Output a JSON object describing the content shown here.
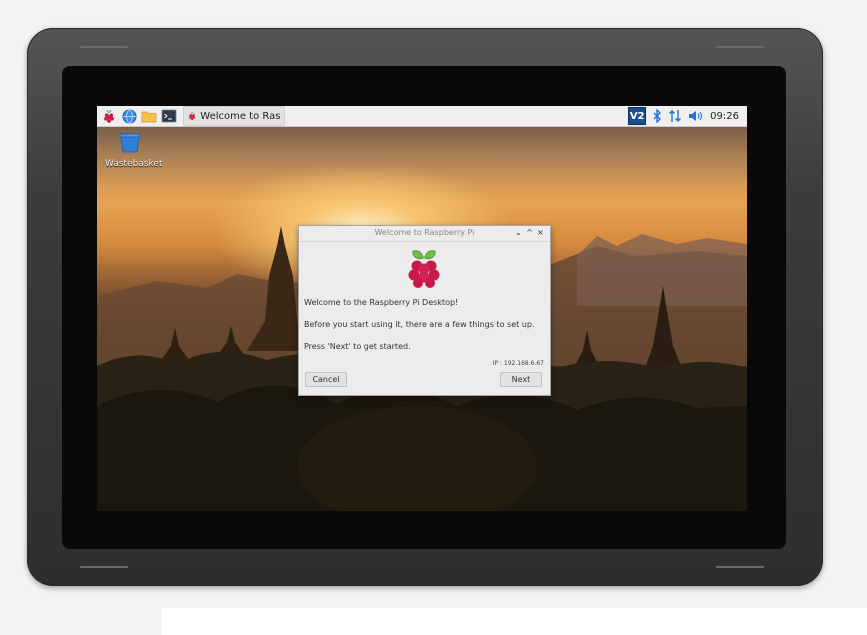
{
  "taskbar": {
    "launchers": [
      {
        "name": "raspberry-menu",
        "icon": "raspberry-icon"
      },
      {
        "name": "web-browser",
        "icon": "globe-icon"
      },
      {
        "name": "file-manager",
        "icon": "folder-icon"
      },
      {
        "name": "terminal",
        "icon": "terminal-icon"
      }
    ],
    "task": {
      "label": "Welcome to Raspberr...",
      "icon": "raspberry-icon"
    },
    "tray": {
      "vnc_label": "V2",
      "icons": [
        "bluetooth-icon",
        "network-updown-icon",
        "volume-icon"
      ],
      "clock": "09:26"
    }
  },
  "desktop": {
    "icons": [
      {
        "label": "Wastebasket",
        "icon": "wastebasket-icon"
      }
    ]
  },
  "dialog": {
    "title": "Welcome to Raspberry Pi",
    "controls": {
      "minimize": "⌄",
      "maximize": "^",
      "close": "×"
    },
    "logo": "raspberry-pi-logo",
    "line1": "Welcome to the Raspberry Pi Desktop!",
    "line2": "Before you start using it, there are a few things to set up.",
    "line3": "Press 'Next' to get started.",
    "ip": "IP : 192.168.6.67",
    "cancel_label": "Cancel",
    "next_label": "Next"
  },
  "colors": {
    "taskbar_bg": "#efefef",
    "dialog_bg": "#ececec",
    "raspberry_red": "#c51a4a",
    "leaf_green": "#6cc04a",
    "vnc_blue": "#1d4e8f",
    "bluetooth_blue": "#1e73d6"
  }
}
